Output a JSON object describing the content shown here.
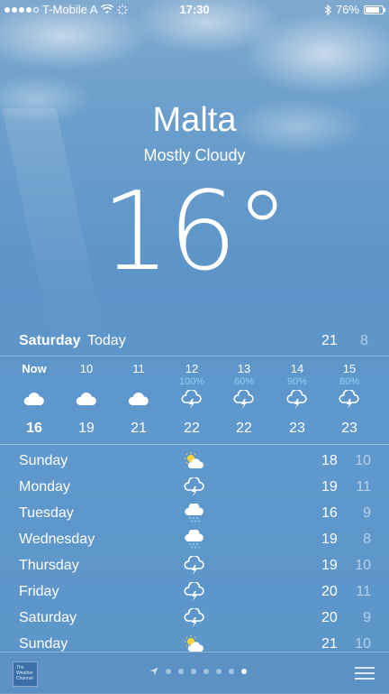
{
  "status_bar": {
    "carrier": "T-Mobile A",
    "time": "17:30",
    "battery": "76%",
    "battery_level": 0.76,
    "signal_bars_filled": 4,
    "signal_bars_total": 5
  },
  "location": {
    "city": "Malta",
    "condition": "Mostly Cloudy",
    "temperature": "16°"
  },
  "today": {
    "day": "Saturday",
    "label": "Today",
    "high": "21",
    "low": "8"
  },
  "hourly": [
    {
      "hour": "Now",
      "precip": "",
      "icon": "cloud-icon",
      "temp": "16"
    },
    {
      "hour": "10",
      "precip": "",
      "icon": "cloud-icon",
      "temp": "19"
    },
    {
      "hour": "11",
      "precip": "",
      "icon": "cloud-icon",
      "temp": "21"
    },
    {
      "hour": "12",
      "precip": "100%",
      "icon": "thunderstorm-icon",
      "temp": "22"
    },
    {
      "hour": "13",
      "precip": "60%",
      "icon": "thunderstorm-icon",
      "temp": "22"
    },
    {
      "hour": "14",
      "precip": "90%",
      "icon": "thunderstorm-icon",
      "temp": "23"
    },
    {
      "hour": "15",
      "precip": "80%",
      "icon": "thunderstorm-icon",
      "temp": "23"
    }
  ],
  "daily": [
    {
      "day": "Sunday",
      "icon": "partly-sunny-icon",
      "high": "18",
      "low": "10"
    },
    {
      "day": "Monday",
      "icon": "thunderstorm-icon",
      "high": "19",
      "low": "11"
    },
    {
      "day": "Tuesday",
      "icon": "rain-icon",
      "high": "16",
      "low": "9"
    },
    {
      "day": "Wednesday",
      "icon": "rain-icon",
      "high": "19",
      "low": "8"
    },
    {
      "day": "Thursday",
      "icon": "thunderstorm-icon",
      "high": "19",
      "low": "10"
    },
    {
      "day": "Friday",
      "icon": "thunderstorm-icon",
      "high": "20",
      "low": "11"
    },
    {
      "day": "Saturday",
      "icon": "thunderstorm-icon",
      "high": "20",
      "low": "9"
    },
    {
      "day": "Sunday",
      "icon": "partly-sunny-icon",
      "high": "21",
      "low": "10"
    }
  ],
  "bottom_bar": {
    "logo_text": "The Weather Channel",
    "page_count": 7,
    "active_page": 7
  },
  "colors": {
    "precip_text": "#8fd0f5",
    "sun": "#f5d33b"
  }
}
